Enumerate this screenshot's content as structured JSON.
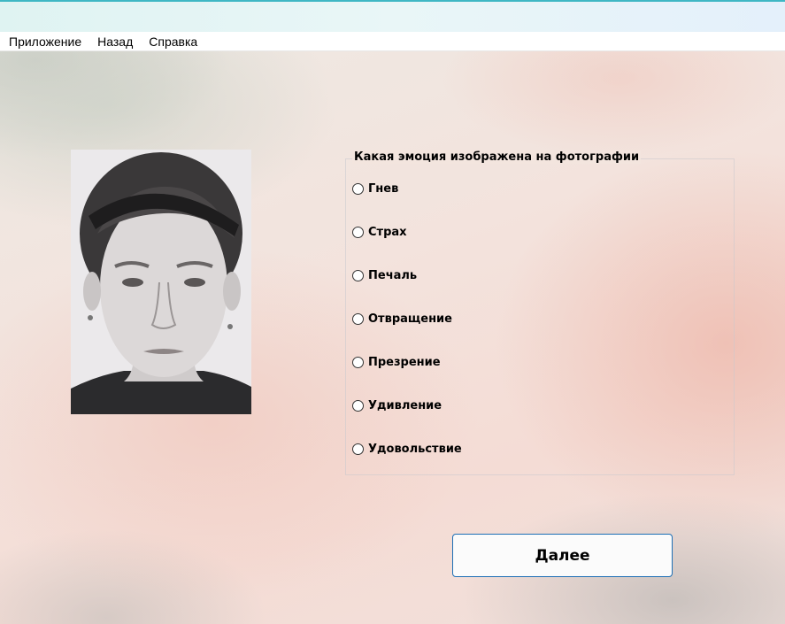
{
  "menu": {
    "items": [
      {
        "label": "Приложение"
      },
      {
        "label": "Назад"
      },
      {
        "label": "Справка"
      }
    ]
  },
  "question": {
    "label": "Какая эмоция изображена на фотографии",
    "options": [
      {
        "label": "Гнев"
      },
      {
        "label": "Страх"
      },
      {
        "label": "Печаль"
      },
      {
        "label": "Отвращение"
      },
      {
        "label": "Презрение"
      },
      {
        "label": "Удивление"
      },
      {
        "label": "Удовольствие"
      }
    ]
  },
  "buttons": {
    "next_label": "Далее"
  },
  "colors": {
    "accent": "#1e6fb5",
    "titlebar_accent": "#3fb7c4"
  }
}
